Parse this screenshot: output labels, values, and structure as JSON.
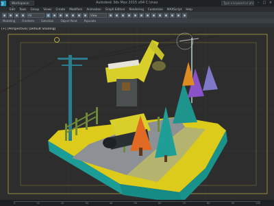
{
  "app": {
    "title": "Autodesk 3ds Max 2015 x64    C:\\max",
    "workspace": "Workspace: Default",
    "search_placeholder": "Type a keyword or phrase"
  },
  "menu": [
    "Edit",
    "Tools",
    "Group",
    "Views",
    "Create",
    "Modifiers",
    "Animation",
    "Graph Editors",
    "Rendering",
    "Customize",
    "MAXScript",
    "Help"
  ],
  "toolbar": {
    "selection_filter": "All",
    "view_dropdown": "View"
  },
  "ribbon": {
    "tabs": [
      "Modeling",
      "Freeform",
      "Selection",
      "Object Paint",
      "Populate"
    ]
  },
  "viewport": {
    "label": "[+] [Perspective] [Default Shading]",
    "selection_brackets": "[+]"
  },
  "timeline": {
    "ticks": [
      "0",
      "10",
      "20",
      "30",
      "40",
      "50",
      "60",
      "70",
      "80",
      "90",
      "100"
    ]
  },
  "colors": {
    "ground_top": "#e2cf1c",
    "ground_side": "#1aa6a0",
    "road": "#8e9296",
    "excavator": "#d9cf2a",
    "tree_teal": "#1f9e95",
    "tree_orange": "#e06a22",
    "tree_purple": "#8a52c9",
    "fence": "#6f8a3a",
    "pole": "#2c7e8f"
  }
}
